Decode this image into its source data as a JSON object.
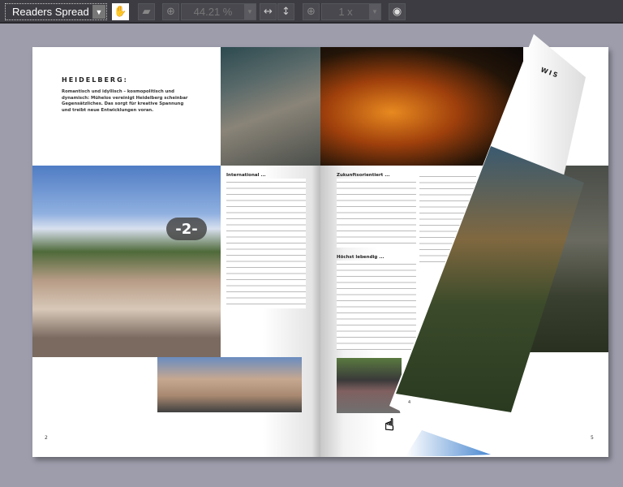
{
  "toolbar": {
    "view_mode": "Readers Spread",
    "zoom": "44.21 %",
    "page_step": "1 x",
    "icons": [
      "hand-tool-icon",
      "ruler-icon",
      "zoom-in-icon",
      "fit-width-icon",
      "fit-height-icon",
      "add-icon",
      "settings-icon"
    ]
  },
  "left_page": {
    "title": "HEIDELBERG:",
    "intro": "Romantisch und idyllisch – kosmopolitisch und dynamisch: Mühelos vereinigt Heidelberg scheinbar Gegensätzliches. Das sorgt für kreative Spannung und treibt neue Entwicklungen voran.",
    "section_heading": "International ...",
    "page_badge": "-2-",
    "page_number": "2"
  },
  "right_page": {
    "section_heading_1": "Zukunftsorientiert ...",
    "section_heading_2": "Höchst lebendig ...",
    "page_number": "5",
    "turning_page_title": "WIS",
    "turning_page_number": "4"
  }
}
